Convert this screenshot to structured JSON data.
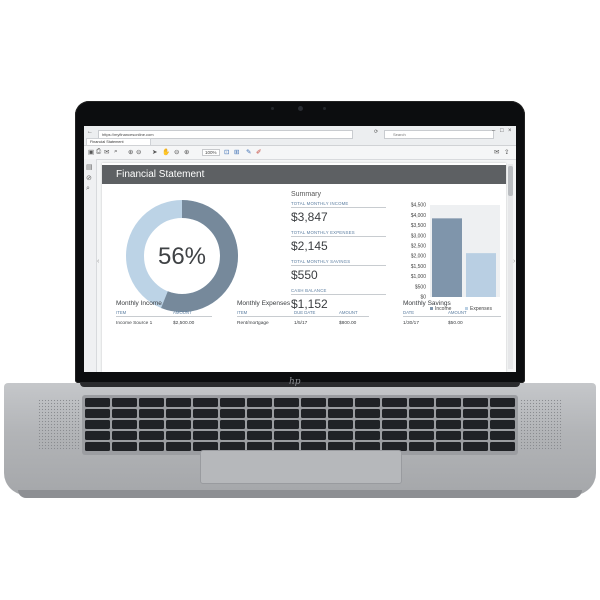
{
  "browser": {
    "url": "https://myfinancesonline.com",
    "tab_title": "Financial Statement",
    "search_placeholder": "Search"
  },
  "viewer": {
    "zoom": "100%"
  },
  "document": {
    "title": "Financial Statement",
    "donut": {
      "percent_label": "56%",
      "percent_value": 56
    },
    "summary": {
      "title": "Summary",
      "items": [
        {
          "label": "TOTAL MONTHLY INCOME",
          "value": "$3,847"
        },
        {
          "label": "TOTAL MONTHLY EXPENSES",
          "value": "$2,145"
        },
        {
          "label": "TOTAL MONTHLY SAVINGS",
          "value": "$550"
        },
        {
          "label": "CASH BALANCE",
          "value": "$1,152"
        }
      ]
    },
    "tables": [
      {
        "title": "Monthly Income",
        "headers": [
          "ITEM",
          "AMOUNT"
        ],
        "rows": [
          [
            "Income Source 1",
            "$2,500.00"
          ]
        ]
      },
      {
        "title": "Monthly Expenses",
        "headers": [
          "ITEM",
          "DUE DATE",
          "AMOUNT"
        ],
        "rows": [
          [
            "Rent/mortgage",
            "1/5/17",
            "$800.00"
          ]
        ]
      },
      {
        "title": "Monthly Savings",
        "headers": [
          "DATE",
          "AMOUNT"
        ],
        "rows": [
          [
            "1/30/17",
            "$50.00"
          ]
        ]
      }
    ]
  },
  "chart_data": {
    "type": "bar",
    "categories": [
      "Income",
      "Expenses"
    ],
    "values": [
      3847,
      2145
    ],
    "ylim": [
      0,
      4500
    ],
    "yticks": [
      "$4,500",
      "$4,000",
      "$3,500",
      "$3,000",
      "$2,500",
      "$2,000",
      "$1,500",
      "$1,000",
      "$500",
      "$0"
    ],
    "legend": [
      "Income",
      "Expenses"
    ],
    "legend_position": "bottom",
    "colors": {
      "Income": "#7f95ab",
      "Expenses": "#b9cfe3"
    }
  },
  "colors": {
    "donut_filled": "#76899b",
    "donut_rest": "#bcd3e6",
    "header_bar": "#5d6063"
  },
  "brand": {
    "logo_text": "hp"
  }
}
